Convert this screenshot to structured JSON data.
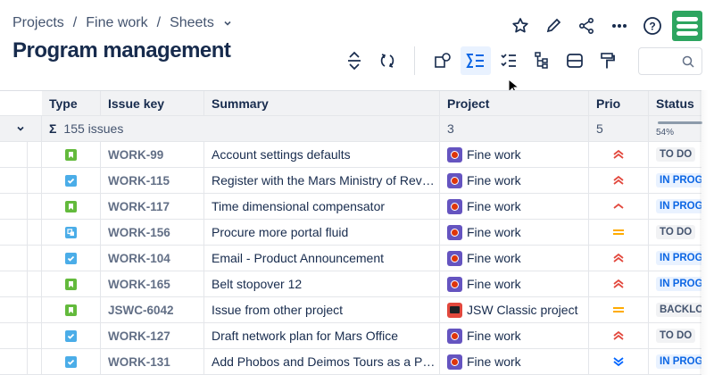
{
  "breadcrumb": [
    "Projects",
    "Fine work",
    "Sheets"
  ],
  "title": "Program management",
  "search": {
    "placeholder": ""
  },
  "columns": [
    "Type",
    "Issue key",
    "Summary",
    "Project",
    "Prio",
    "Status"
  ],
  "summary_row": {
    "label": "155 issues",
    "project_count": "3",
    "prio_count": "5",
    "status_percent": "54%"
  },
  "rows": [
    {
      "type": "story",
      "key": "WORK-99",
      "summary": "Account settings defaults",
      "project": "Fine work",
      "prio": "highest",
      "status": "TO DO"
    },
    {
      "type": "task",
      "key": "WORK-115",
      "summary": "Register with the Mars Ministry of Rev…",
      "project": "Fine work",
      "prio": "highest",
      "status": "IN PROG"
    },
    {
      "type": "story",
      "key": "WORK-117",
      "summary": "Time dimensional compensator",
      "project": "Fine work",
      "prio": "high",
      "status": "IN PROG"
    },
    {
      "type": "subtask",
      "key": "WORK-156",
      "summary": "Procure more portal fluid",
      "project": "Fine work",
      "prio": "medium",
      "status": "TO DO"
    },
    {
      "type": "task",
      "key": "WORK-104",
      "summary": "Email - Product Announcement",
      "project": "Fine work",
      "prio": "highest",
      "status": "IN PROG"
    },
    {
      "type": "story",
      "key": "WORK-165",
      "summary": "Belt stopover 12",
      "project": "Fine work",
      "prio": "highest",
      "status": "IN PROG"
    },
    {
      "type": "story",
      "key": "JSWC-6042",
      "summary": "Issue from other project",
      "project": "JSW Classic project",
      "prio": "medium",
      "status": "BACKLO"
    },
    {
      "type": "task",
      "key": "WORK-127",
      "summary": "Draft network plan for Mars Office",
      "project": "Fine work",
      "prio": "highest",
      "status": "TO DO"
    },
    {
      "type": "task",
      "key": "WORK-131",
      "summary": "Add Phobos and Deimos Tours as a P…",
      "project": "Fine work",
      "prio": "lowest",
      "status": "IN PROG"
    }
  ],
  "colors": {
    "accent": "#0c66e4",
    "story": "#63ba3c",
    "task": "#4bade8",
    "prio_high": "#e2483d",
    "prio_medium": "#ffab00",
    "prio_low": "#0065ff"
  }
}
